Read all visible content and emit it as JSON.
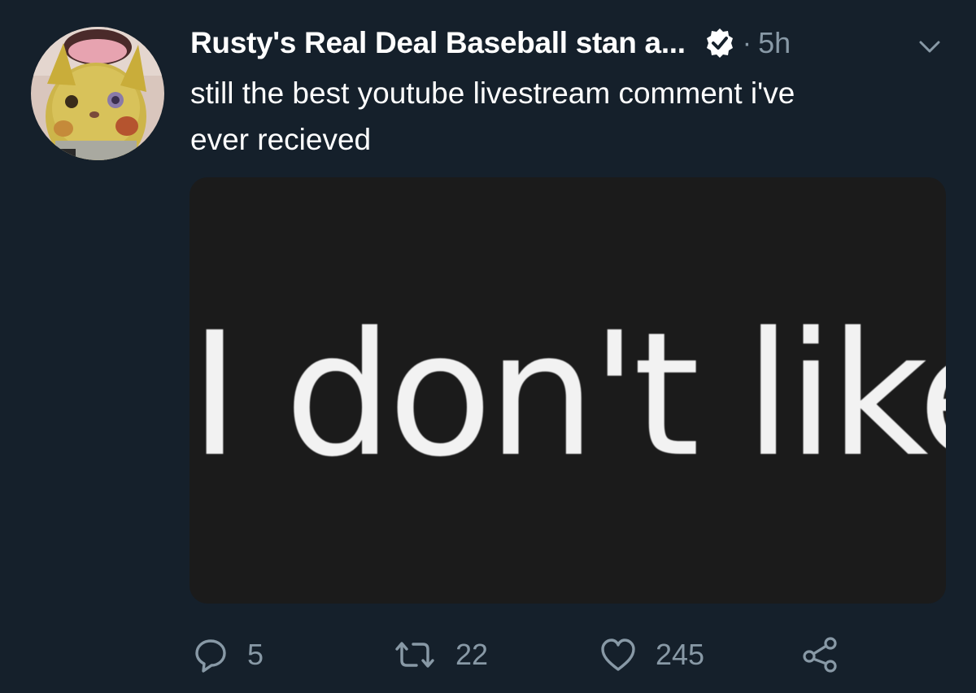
{
  "tweet": {
    "display_name": "Rusty's Real Deal Baseball stan a...",
    "verified_icon": "verified-badge-icon",
    "separator": "·",
    "timestamp": "5h",
    "text": "still the best youtube livestream comment i've\never recieved",
    "media": {
      "text": "I don't like"
    },
    "actions": {
      "reply_count": "5",
      "retweet_count": "22",
      "like_count": "245"
    }
  },
  "colors": {
    "background": "#15202b",
    "secondary_text": "#8899a6",
    "primary_text": "#ffffff",
    "media_background": "#1b1b1b"
  }
}
